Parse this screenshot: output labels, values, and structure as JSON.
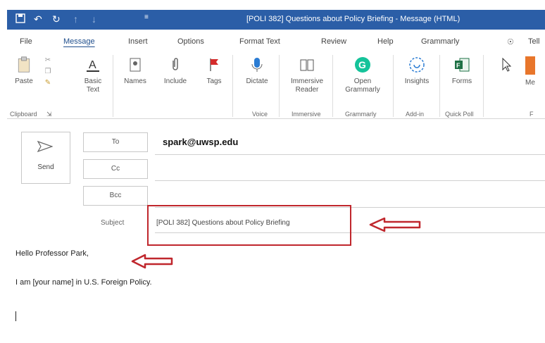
{
  "window": {
    "title": "[POLI 382] Questions about Policy Briefing  -  Message (HTML)",
    "accent_color": "#2b5ea7"
  },
  "quick_access": [
    "save-icon",
    "undo-icon",
    "redo-icon",
    "up-arrow-icon",
    "down-arrow-icon"
  ],
  "tabs": {
    "file": "File",
    "message": "Message",
    "insert": "Insert",
    "options": "Options",
    "format_text": "Format Text",
    "review": "Review",
    "help": "Help",
    "grammarly": "Grammarly",
    "tell": "Tell"
  },
  "ribbon": {
    "paste": "Paste",
    "basic_text": "Basic Text",
    "names": "Names",
    "include": "Include",
    "tags": "Tags",
    "dictate": "Dictate",
    "immersive_reader": "Immersive Reader",
    "open_grammarly": "Open Grammarly",
    "insights": "Insights",
    "forms": "Forms",
    "more": "Me",
    "groups": {
      "clipboard": "Clipboard",
      "voice": "Voice",
      "immersive": "Immersive",
      "grammarly": "Grammarly",
      "add_in": "Add-in",
      "quick_poll": "Quick Poll",
      "more": "F"
    }
  },
  "compose": {
    "send_label": "Send",
    "to_label": "To",
    "cc_label": "Cc",
    "bcc_label": "Bcc",
    "subject_label": "Subject",
    "to_value": "spark@uwsp.edu",
    "subject_value": "[POLI 382] Questions about Policy Briefing",
    "body_line1": "Hello Professor Park,",
    "body_line2": "I am [your name] in U.S. Foreign Policy."
  },
  "annotation_color": "#c0272d"
}
